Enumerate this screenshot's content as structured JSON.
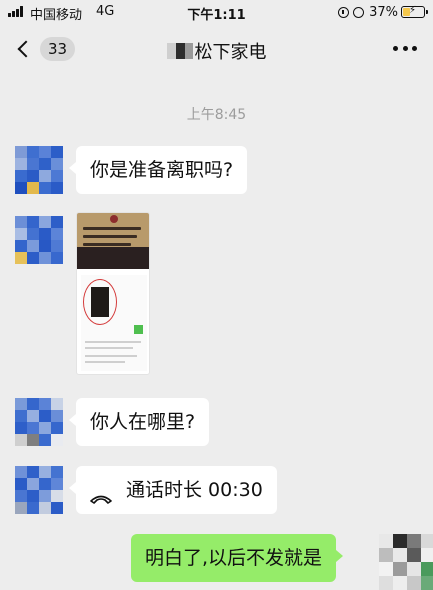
{
  "status_bar": {
    "carrier": "中国移动",
    "network": "4G",
    "time": "下午1:11",
    "battery_percent": "37%",
    "battery_level": 0.37,
    "icons": [
      "signal-icon",
      "lock-rotation-icon",
      "alarm-icon",
      "battery-charging-icon"
    ]
  },
  "nav": {
    "unread_count": "33",
    "chat_title": "松下家电",
    "icons": [
      "back-chevron-icon",
      "more-options-icon"
    ]
  },
  "messages": {
    "timestamp": "上午8:45",
    "msg1": "你是准备离职吗?",
    "msg3": "你人在哪里?",
    "call_label": "通话时长 00:30",
    "reply": "明白了,以后不发就是"
  },
  "colors": {
    "chat_background": "#ededed",
    "incoming_bubble": "#ffffff",
    "outgoing_bubble": "#95ec69",
    "timestamp_text": "#9c9c9c"
  }
}
